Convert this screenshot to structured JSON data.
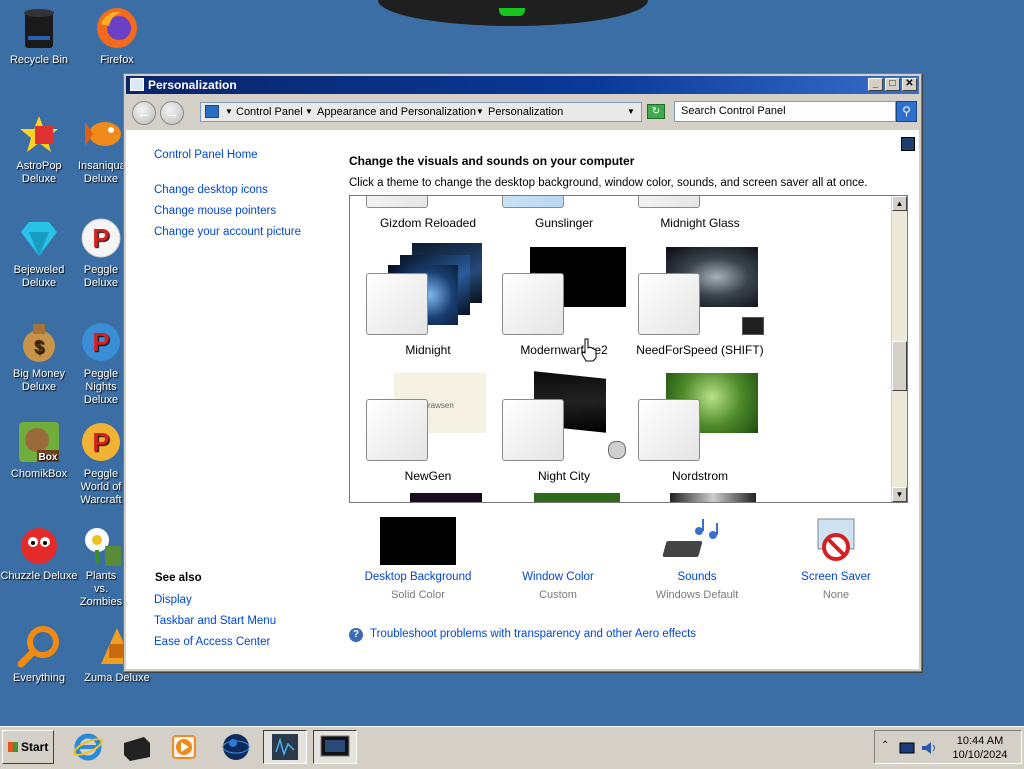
{
  "desktop": {
    "icons": [
      {
        "label": "Recycle Bin",
        "icon": "recycle-bin-icon"
      },
      {
        "label": "Firefox",
        "icon": "firefox-icon"
      },
      {
        "label": "AstroPop Deluxe",
        "icon": "astropop-icon"
      },
      {
        "label": "Insaniquarium Deluxe",
        "icon": "insaniquarium-icon"
      },
      {
        "label": "Bejeweled Deluxe",
        "icon": "bejeweled-icon"
      },
      {
        "label": "Peggle Deluxe",
        "icon": "peggle-icon"
      },
      {
        "label": "Big Money Deluxe",
        "icon": "big-money-icon"
      },
      {
        "label": "Peggle Nights Deluxe",
        "icon": "peggle-nights-icon"
      },
      {
        "label": "ChomikBox",
        "icon": "chomikbox-icon"
      },
      {
        "label": "Peggle World of Warcraft",
        "icon": "peggle-wow-icon"
      },
      {
        "label": "Chuzzle Deluxe",
        "icon": "chuzzle-icon"
      },
      {
        "label": "Plants vs. Zombies",
        "icon": "plants-vs-zombies-icon"
      },
      {
        "label": "Everything",
        "icon": "everything-search-icon"
      },
      {
        "label": "Zuma Deluxe",
        "icon": "zuma-icon"
      }
    ],
    "icon_box_text": "Box"
  },
  "window": {
    "title": "Personalization",
    "controls": {
      "minimize": "_",
      "maximize": "□",
      "close": "✕"
    },
    "address": {
      "crumbs": [
        "Control Panel",
        "Appearance and Personalization",
        "Personalization"
      ]
    },
    "search_placeholder": "Search Control Panel"
  },
  "left_nav": {
    "home": "Control Panel Home",
    "links": [
      "Change desktop icons",
      "Change mouse pointers",
      "Change your account picture"
    ],
    "see_also_title": "See also",
    "see_also": [
      "Display",
      "Taskbar and Start Menu",
      "Ease of Access Center"
    ]
  },
  "main": {
    "title": "Change the visuals and sounds on your computer",
    "subtitle": "Click a theme to change the desktop background, window color, sounds, and screen saver all at once.",
    "theme_rows": [
      [
        "Gizdom Reloaded",
        "Gunslinger",
        "Midnight Glass"
      ],
      [
        "Midnight",
        "Modernwarfare2",
        "NeedForSpeed (SHIFT)"
      ],
      [
        "NewGen",
        "Night City",
        "Nordstrom"
      ]
    ],
    "newgen_text": "rawsen",
    "bottom_items": [
      {
        "label": "Desktop Background",
        "sub": "Solid Color"
      },
      {
        "label": "Window Color",
        "sub": "Custom"
      },
      {
        "label": "Sounds",
        "sub": "Windows Default"
      },
      {
        "label": "Screen Saver",
        "sub": "None"
      }
    ],
    "troubleshoot": "Troubleshoot problems with transparency and other Aero effects"
  },
  "taskbar": {
    "start": "Start",
    "time": "10:44 AM",
    "date": "10/10/2024"
  },
  "colors": {
    "desktop": "#3a6ea5",
    "link": "#0046d5",
    "titlebar": "#0a246a"
  }
}
